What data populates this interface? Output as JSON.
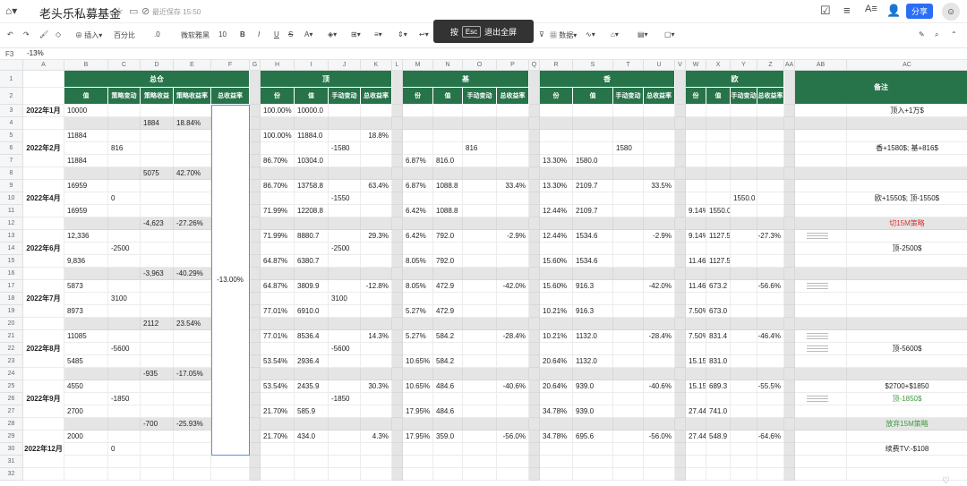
{
  "app": {
    "doc_title": "老头乐私募基金",
    "saved_status": "最近保存 15:50",
    "share_label": "分享",
    "fullscreen_hint_pre": "按",
    "fullscreen_hint_key": "Esc",
    "fullscreen_hint_post": "退出全屏"
  },
  "toolbar": {
    "insert": "插入",
    "percent": "百分比",
    "decimals": ".0",
    "font": "微软雅黑",
    "size": "10",
    "data": "数据"
  },
  "formula": {
    "cell": "F3",
    "value": "-13%"
  },
  "columns": [
    {
      "k": "A",
      "w": 46
    },
    {
      "k": "B",
      "w": 49
    },
    {
      "k": "C",
      "w": 36
    },
    {
      "k": "D",
      "w": 37
    },
    {
      "k": "E",
      "w": 42
    },
    {
      "k": "F",
      "w": 43
    },
    {
      "k": "G",
      "w": 12
    },
    {
      "k": "H",
      "w": 38
    },
    {
      "k": "I",
      "w": 38
    },
    {
      "k": "J",
      "w": 36
    },
    {
      "k": "K",
      "w": 35
    },
    {
      "k": "L",
      "w": 12
    },
    {
      "k": "M",
      "w": 34
    },
    {
      "k": "N",
      "w": 33
    },
    {
      "k": "O",
      "w": 38
    },
    {
      "k": "P",
      "w": 36
    },
    {
      "k": "Q",
      "w": 12
    },
    {
      "k": "R",
      "w": 37
    },
    {
      "k": "S",
      "w": 45
    },
    {
      "k": "T",
      "w": 34
    },
    {
      "k": "U",
      "w": 35
    },
    {
      "k": "V",
      "w": 12
    },
    {
      "k": "W",
      "w": 23
    },
    {
      "k": "X",
      "w": 27
    },
    {
      "k": "Y",
      "w": 30
    },
    {
      "k": "Z",
      "w": 30
    },
    {
      "k": "AA",
      "w": 12
    },
    {
      "k": "AB",
      "w": 58
    },
    {
      "k": "AC",
      "w": 135
    }
  ],
  "groups": [
    {
      "label": "总仓",
      "from": 1,
      "to": 5
    },
    {
      "label": "顶",
      "from": 7,
      "to": 10
    },
    {
      "label": "基",
      "from": 12,
      "to": 15
    },
    {
      "label": "香",
      "from": 17,
      "to": 20
    },
    {
      "label": "欧",
      "from": 22,
      "to": 25
    },
    {
      "label": "备注",
      "from": 27,
      "to": 28
    }
  ],
  "subheaders": {
    "B": "值",
    "C": "策略变动",
    "D": "策略收益",
    "E": "策略收益率",
    "F": "总收益率",
    "H": "份",
    "I": "值",
    "J": "手动变动",
    "K": "总收益率",
    "M": "份",
    "N": "值",
    "O": "手动变动",
    "P": "总收益率",
    "R": "份",
    "S": "值",
    "T": "手动变动",
    "U": "总收益率",
    "W": "份",
    "X": "值",
    "Y": "手动变动",
    "Z": "总收益率"
  },
  "band_rows": [
    4,
    8,
    12,
    16,
    20,
    24,
    28
  ],
  "months": [
    {
      "label": "2022年1月",
      "row": 3
    },
    {
      "label": "2022年2月",
      "row": 6
    },
    {
      "label": "2022年4月",
      "row": 10
    },
    {
      "label": "2022年6月",
      "row": 14
    },
    {
      "label": "2022年7月",
      "row": 18
    },
    {
      "label": "2022年8月",
      "row": 22
    },
    {
      "label": "2022年9月",
      "row": 26
    },
    {
      "label": "2022年12月",
      "row": 30
    }
  ],
  "total_return": "-13.00%",
  "cells": [
    {
      "r": 3,
      "c": "B",
      "v": "10000"
    },
    {
      "r": 3,
      "c": "H",
      "v": "100.00%"
    },
    {
      "r": 3,
      "c": "I",
      "v": "10000.0"
    },
    {
      "r": 3,
      "c": "AC",
      "v": "顶入+1万$"
    },
    {
      "r": 4,
      "c": "D",
      "v": "1884"
    },
    {
      "r": 4,
      "c": "E",
      "v": "18.84%"
    },
    {
      "r": 5,
      "c": "B",
      "v": "11884"
    },
    {
      "r": 5,
      "c": "H",
      "v": "100.00%"
    },
    {
      "r": 5,
      "c": "I",
      "v": "11884.0"
    },
    {
      "r": 5,
      "c": "K",
      "v": "18.8%"
    },
    {
      "r": 6,
      "c": "C",
      "v": "816"
    },
    {
      "r": 6,
      "c": "J",
      "v": "-1580"
    },
    {
      "r": 6,
      "c": "O",
      "v": "816"
    },
    {
      "r": 6,
      "c": "T",
      "v": "1580"
    },
    {
      "r": 6,
      "c": "AC",
      "v": "香+1580$; 基+816$"
    },
    {
      "r": 7,
      "c": "B",
      "v": "11884"
    },
    {
      "r": 7,
      "c": "H",
      "v": "86.70%"
    },
    {
      "r": 7,
      "c": "I",
      "v": "10304.0"
    },
    {
      "r": 7,
      "c": "M",
      "v": "6.87%"
    },
    {
      "r": 7,
      "c": "N",
      "v": "816.0"
    },
    {
      "r": 7,
      "c": "R",
      "v": "13.30%"
    },
    {
      "r": 7,
      "c": "S",
      "v": "1580.0"
    },
    {
      "r": 8,
      "c": "D",
      "v": "5075"
    },
    {
      "r": 8,
      "c": "E",
      "v": "42.70%"
    },
    {
      "r": 9,
      "c": "B",
      "v": "16959"
    },
    {
      "r": 9,
      "c": "H",
      "v": "86.70%"
    },
    {
      "r": 9,
      "c": "I",
      "v": "13758.8"
    },
    {
      "r": 9,
      "c": "K",
      "v": "63.4%"
    },
    {
      "r": 9,
      "c": "M",
      "v": "6.87%"
    },
    {
      "r": 9,
      "c": "N",
      "v": "1088.8"
    },
    {
      "r": 9,
      "c": "P",
      "v": "33.4%"
    },
    {
      "r": 9,
      "c": "R",
      "v": "13.30%"
    },
    {
      "r": 9,
      "c": "S",
      "v": "2109.7"
    },
    {
      "r": 9,
      "c": "U",
      "v": "33.5%"
    },
    {
      "r": 10,
      "c": "C",
      "v": "0"
    },
    {
      "r": 10,
      "c": "J",
      "v": "-1550"
    },
    {
      "r": 10,
      "c": "Y",
      "v": "1550.0"
    },
    {
      "r": 10,
      "c": "AC",
      "v": "欧+1550$; 顶-1550$"
    },
    {
      "r": 11,
      "c": "B",
      "v": "16959"
    },
    {
      "r": 11,
      "c": "H",
      "v": "71.99%"
    },
    {
      "r": 11,
      "c": "I",
      "v": "12208.8"
    },
    {
      "r": 11,
      "c": "M",
      "v": "6.42%"
    },
    {
      "r": 11,
      "c": "N",
      "v": "1088.8"
    },
    {
      "r": 11,
      "c": "R",
      "v": "12.44%"
    },
    {
      "r": 11,
      "c": "S",
      "v": "2109.7"
    },
    {
      "r": 11,
      "c": "W",
      "v": "9.14%"
    },
    {
      "r": 11,
      "c": "X",
      "v": "1550.0"
    },
    {
      "r": 12,
      "c": "D",
      "v": "-4,623"
    },
    {
      "r": 12,
      "c": "E",
      "v": "-27.26%"
    },
    {
      "r": 12,
      "c": "AC",
      "v": "切15M策略",
      "cls": "red"
    },
    {
      "r": 13,
      "c": "B",
      "v": "12,336"
    },
    {
      "r": 13,
      "c": "H",
      "v": "71.99%"
    },
    {
      "r": 13,
      "c": "I",
      "v": "8880.7"
    },
    {
      "r": 13,
      "c": "K",
      "v": "29.3%"
    },
    {
      "r": 13,
      "c": "M",
      "v": "6.42%"
    },
    {
      "r": 13,
      "c": "N",
      "v": "792.0"
    },
    {
      "r": 13,
      "c": "P",
      "v": "-2.9%"
    },
    {
      "r": 13,
      "c": "R",
      "v": "12.44%"
    },
    {
      "r": 13,
      "c": "S",
      "v": "1534.6"
    },
    {
      "r": 13,
      "c": "U",
      "v": "-2.9%"
    },
    {
      "r": 13,
      "c": "W",
      "v": "9.14%"
    },
    {
      "r": 13,
      "c": "X",
      "v": "1127.5"
    },
    {
      "r": 13,
      "c": "Z",
      "v": "-27.3%"
    },
    {
      "r": 14,
      "c": "C",
      "v": "-2500"
    },
    {
      "r": 14,
      "c": "J",
      "v": "-2500"
    },
    {
      "r": 14,
      "c": "AC",
      "v": "顶-2500$"
    },
    {
      "r": 15,
      "c": "B",
      "v": "9,836"
    },
    {
      "r": 15,
      "c": "H",
      "v": "64.87%"
    },
    {
      "r": 15,
      "c": "I",
      "v": "6380.7"
    },
    {
      "r": 15,
      "c": "M",
      "v": "8.05%"
    },
    {
      "r": 15,
      "c": "N",
      "v": "792.0"
    },
    {
      "r": 15,
      "c": "R",
      "v": "15.60%"
    },
    {
      "r": 15,
      "c": "S",
      "v": "1534.6"
    },
    {
      "r": 15,
      "c": "W",
      "v": "11.46%"
    },
    {
      "r": 15,
      "c": "X",
      "v": "1127.5"
    },
    {
      "r": 16,
      "c": "D",
      "v": "-3,963"
    },
    {
      "r": 16,
      "c": "E",
      "v": "-40.29%"
    },
    {
      "r": 17,
      "c": "B",
      "v": "5873"
    },
    {
      "r": 17,
      "c": "H",
      "v": "64.87%"
    },
    {
      "r": 17,
      "c": "I",
      "v": "3809.9"
    },
    {
      "r": 17,
      "c": "K",
      "v": "-12.8%"
    },
    {
      "r": 17,
      "c": "M",
      "v": "8.05%"
    },
    {
      "r": 17,
      "c": "N",
      "v": "472.9"
    },
    {
      "r": 17,
      "c": "P",
      "v": "-42.0%"
    },
    {
      "r": 17,
      "c": "R",
      "v": "15.60%"
    },
    {
      "r": 17,
      "c": "S",
      "v": "916.3"
    },
    {
      "r": 17,
      "c": "U",
      "v": "-42.0%"
    },
    {
      "r": 17,
      "c": "W",
      "v": "11.46%"
    },
    {
      "r": 17,
      "c": "X",
      "v": "673.2"
    },
    {
      "r": 17,
      "c": "Z",
      "v": "-56.6%"
    },
    {
      "r": 18,
      "c": "C",
      "v": "3100"
    },
    {
      "r": 18,
      "c": "J",
      "v": "3100"
    },
    {
      "r": 19,
      "c": "B",
      "v": "8973"
    },
    {
      "r": 19,
      "c": "H",
      "v": "77.01%"
    },
    {
      "r": 19,
      "c": "I",
      "v": "6910.0"
    },
    {
      "r": 19,
      "c": "M",
      "v": "5.27%"
    },
    {
      "r": 19,
      "c": "N",
      "v": "472.9"
    },
    {
      "r": 19,
      "c": "R",
      "v": "10.21%"
    },
    {
      "r": 19,
      "c": "S",
      "v": "916.3"
    },
    {
      "r": 19,
      "c": "W",
      "v": "7.50%"
    },
    {
      "r": 19,
      "c": "X",
      "v": "673.0"
    },
    {
      "r": 20,
      "c": "D",
      "v": "2112"
    },
    {
      "r": 20,
      "c": "E",
      "v": "23.54%"
    },
    {
      "r": 21,
      "c": "B",
      "v": "11085"
    },
    {
      "r": 21,
      "c": "H",
      "v": "77.01%"
    },
    {
      "r": 21,
      "c": "I",
      "v": "8536.4"
    },
    {
      "r": 21,
      "c": "K",
      "v": "14.3%"
    },
    {
      "r": 21,
      "c": "M",
      "v": "5.27%"
    },
    {
      "r": 21,
      "c": "N",
      "v": "584.2"
    },
    {
      "r": 21,
      "c": "P",
      "v": "-28.4%"
    },
    {
      "r": 21,
      "c": "R",
      "v": "10.21%"
    },
    {
      "r": 21,
      "c": "S",
      "v": "1132.0"
    },
    {
      "r": 21,
      "c": "U",
      "v": "-28.4%"
    },
    {
      "r": 21,
      "c": "W",
      "v": "7.50%"
    },
    {
      "r": 21,
      "c": "X",
      "v": "831.4"
    },
    {
      "r": 21,
      "c": "Z",
      "v": "-46.4%"
    },
    {
      "r": 22,
      "c": "C",
      "v": "-5600"
    },
    {
      "r": 22,
      "c": "J",
      "v": "-5600"
    },
    {
      "r": 22,
      "c": "AC",
      "v": "顶-5600$"
    },
    {
      "r": 23,
      "c": "B",
      "v": "5485"
    },
    {
      "r": 23,
      "c": "H",
      "v": "53.54%"
    },
    {
      "r": 23,
      "c": "I",
      "v": "2936.4"
    },
    {
      "r": 23,
      "c": "M",
      "v": "10.65%"
    },
    {
      "r": 23,
      "c": "N",
      "v": "584.2"
    },
    {
      "r": 23,
      "c": "R",
      "v": "20.64%"
    },
    {
      "r": 23,
      "c": "S",
      "v": "1132.0"
    },
    {
      "r": 23,
      "c": "W",
      "v": "15.15%"
    },
    {
      "r": 23,
      "c": "X",
      "v": "831.0"
    },
    {
      "r": 24,
      "c": "D",
      "v": "-935"
    },
    {
      "r": 24,
      "c": "E",
      "v": "-17.05%"
    },
    {
      "r": 25,
      "c": "B",
      "v": "4550"
    },
    {
      "r": 25,
      "c": "H",
      "v": "53.54%"
    },
    {
      "r": 25,
      "c": "I",
      "v": "2435.9"
    },
    {
      "r": 25,
      "c": "K",
      "v": "30.3%"
    },
    {
      "r": 25,
      "c": "M",
      "v": "10.65%"
    },
    {
      "r": 25,
      "c": "N",
      "v": "484.6"
    },
    {
      "r": 25,
      "c": "P",
      "v": "-40.6%"
    },
    {
      "r": 25,
      "c": "R",
      "v": "20.64%"
    },
    {
      "r": 25,
      "c": "S",
      "v": "939.0"
    },
    {
      "r": 25,
      "c": "U",
      "v": "-40.6%"
    },
    {
      "r": 25,
      "c": "W",
      "v": "15.15%"
    },
    {
      "r": 25,
      "c": "X",
      "v": "689.3"
    },
    {
      "r": 25,
      "c": "Z",
      "v": "-55.5%"
    },
    {
      "r": 25,
      "c": "AC",
      "v": "$2700+$1850"
    },
    {
      "r": 26,
      "c": "C",
      "v": "-1850"
    },
    {
      "r": 26,
      "c": "J",
      "v": "-1850"
    },
    {
      "r": 26,
      "c": "AC",
      "v": "顶-1850$",
      "cls": "green"
    },
    {
      "r": 27,
      "c": "B",
      "v": "2700"
    },
    {
      "r": 27,
      "c": "H",
      "v": "21.70%"
    },
    {
      "r": 27,
      "c": "I",
      "v": "585.9"
    },
    {
      "r": 27,
      "c": "M",
      "v": "17.95%"
    },
    {
      "r": 27,
      "c": "N",
      "v": "484.6"
    },
    {
      "r": 27,
      "c": "R",
      "v": "34.78%"
    },
    {
      "r": 27,
      "c": "S",
      "v": "939.0"
    },
    {
      "r": 27,
      "c": "W",
      "v": "27.44%"
    },
    {
      "r": 27,
      "c": "X",
      "v": "741.0"
    },
    {
      "r": 28,
      "c": "D",
      "v": "-700"
    },
    {
      "r": 28,
      "c": "E",
      "v": "-25.93%"
    },
    {
      "r": 28,
      "c": "AC",
      "v": "放弃15M策略",
      "cls": "green"
    },
    {
      "r": 29,
      "c": "B",
      "v": "2000"
    },
    {
      "r": 29,
      "c": "H",
      "v": "21.70%"
    },
    {
      "r": 29,
      "c": "I",
      "v": "434.0"
    },
    {
      "r": 29,
      "c": "K",
      "v": "4.3%"
    },
    {
      "r": 29,
      "c": "M",
      "v": "17.95%"
    },
    {
      "r": 29,
      "c": "N",
      "v": "359.0"
    },
    {
      "r": 29,
      "c": "P",
      "v": "-56.0%"
    },
    {
      "r": 29,
      "c": "R",
      "v": "34.78%"
    },
    {
      "r": 29,
      "c": "S",
      "v": "695.6"
    },
    {
      "r": 29,
      "c": "U",
      "v": "-56.0%"
    },
    {
      "r": 29,
      "c": "W",
      "v": "27.44%"
    },
    {
      "r": 29,
      "c": "X",
      "v": "548.9"
    },
    {
      "r": 29,
      "c": "Z",
      "v": "-64.6%"
    },
    {
      "r": 30,
      "c": "C",
      "v": "0"
    },
    {
      "r": 30,
      "c": "AC",
      "v": "续费TV:-$108"
    }
  ],
  "thumbs": [
    13,
    17,
    21,
    22,
    26
  ]
}
